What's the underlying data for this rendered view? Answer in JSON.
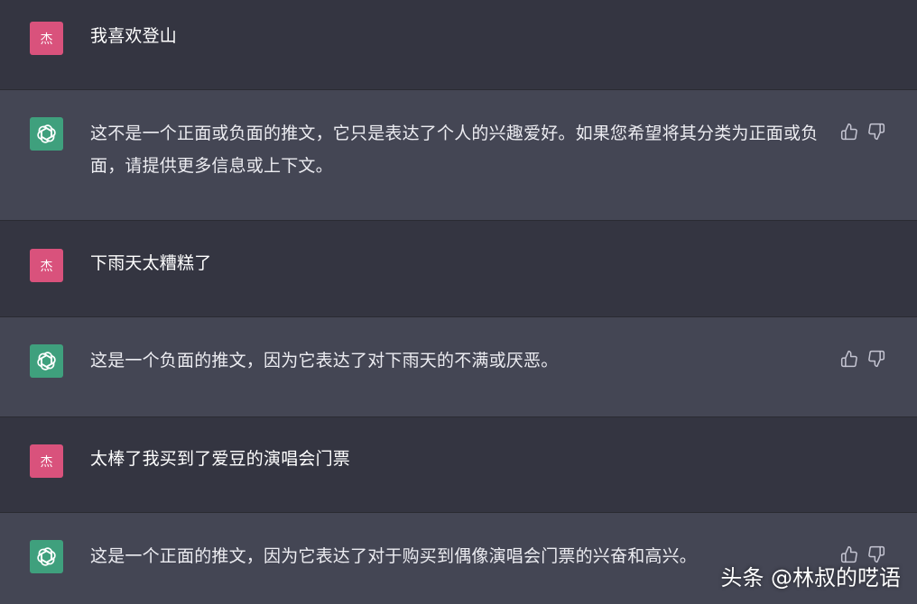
{
  "user_avatar_text": "杰",
  "messages": [
    {
      "role": "user",
      "text": "我喜欢登山"
    },
    {
      "role": "assistant",
      "text": "这不是一个正面或负面的推文，它只是表达了个人的兴趣爱好。如果您希望将其分类为正面或负面，请提供更多信息或上下文。"
    },
    {
      "role": "user",
      "text": "下雨天太糟糕了"
    },
    {
      "role": "assistant",
      "text": "这是一个负面的推文，因为它表达了对下雨天的不满或厌恶。"
    },
    {
      "role": "user",
      "text": "太棒了我买到了爱豆的演唱会门票"
    },
    {
      "role": "assistant",
      "text": "这是一个正面的推文，因为它表达了对于购买到偶像演唱会门票的兴奋和高兴。"
    }
  ],
  "icons": {
    "user_avatar": "user-avatar",
    "bot_avatar": "openai-logo-icon",
    "like": "thumbs-up-icon",
    "dislike": "thumbs-down-icon"
  },
  "watermark": "头条 @林叔的呓语",
  "colors": {
    "user_row_bg": "#343541",
    "assistant_row_bg": "#444654",
    "user_avatar_bg": "#d9527c",
    "bot_avatar_bg": "#3fa07d"
  }
}
